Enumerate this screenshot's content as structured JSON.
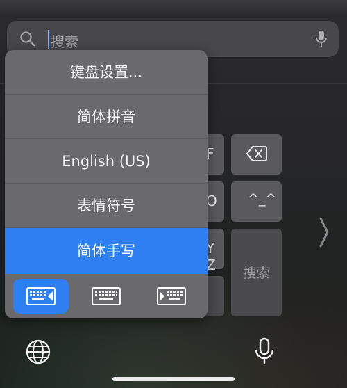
{
  "search": {
    "placeholder": "搜索",
    "search_icon": "magnifier-icon",
    "dictation_icon": "microphone-icon"
  },
  "keyboard": {
    "partial_keys": [
      "F",
      "O",
      "Y Z"
    ],
    "delete_icon": "delete-backspace-icon",
    "emoji_key_label": "^_^",
    "search_key_label": "搜索",
    "next_page_icon": "chevron-right-icon"
  },
  "menu": {
    "items": [
      {
        "label": "键盘设置...",
        "selected": false
      },
      {
        "label": "简体拼音",
        "selected": false
      },
      {
        "label": "English (US)",
        "selected": false
      },
      {
        "label": "表情符号",
        "selected": false
      },
      {
        "label": "简体手写",
        "selected": true
      }
    ],
    "layout_options": [
      {
        "name": "keyboard-left-icon",
        "active": true
      },
      {
        "name": "keyboard-full-icon",
        "active": false
      },
      {
        "name": "keyboard-right-icon",
        "active": false
      }
    ]
  },
  "bottom_bar": {
    "globe_icon": "globe-icon",
    "mic_icon": "microphone-icon"
  },
  "colors": {
    "accent": "#2d7ff2",
    "menu_bg": "#6a6a6d",
    "key_bg": "#5a5a5d",
    "search_bar_bg": "#48484b"
  }
}
